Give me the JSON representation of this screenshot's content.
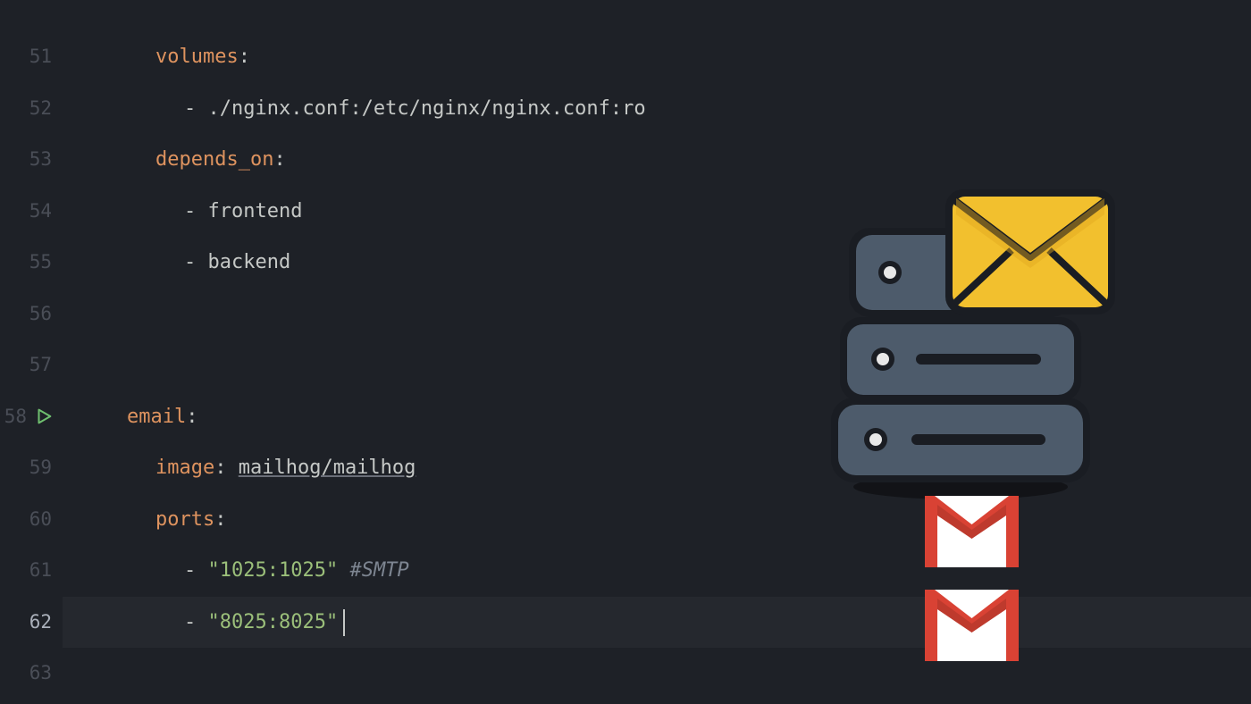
{
  "gutter": {
    "start": 51,
    "active": 62,
    "playAt": 58
  },
  "lines": [
    {
      "num": 51,
      "indent": 2,
      "parts": [
        {
          "t": "key",
          "v": "volumes"
        },
        {
          "t": "colon",
          "v": ":"
        }
      ]
    },
    {
      "num": 52,
      "indent": 3,
      "parts": [
        {
          "t": "dash",
          "v": "- "
        },
        {
          "t": "value",
          "v": "./nginx.conf:/etc/nginx/nginx.conf:ro"
        }
      ]
    },
    {
      "num": 53,
      "indent": 2,
      "parts": [
        {
          "t": "key",
          "v": "depends_on"
        },
        {
          "t": "colon",
          "v": ":"
        }
      ]
    },
    {
      "num": 54,
      "indent": 3,
      "parts": [
        {
          "t": "dash",
          "v": "- "
        },
        {
          "t": "value",
          "v": "frontend"
        }
      ]
    },
    {
      "num": 55,
      "indent": 3,
      "parts": [
        {
          "t": "dash",
          "v": "- "
        },
        {
          "t": "value",
          "v": "backend"
        }
      ]
    },
    {
      "num": 56,
      "indent": 0,
      "parts": []
    },
    {
      "num": 57,
      "indent": 0,
      "parts": []
    },
    {
      "num": 58,
      "indent": 1,
      "parts": [
        {
          "t": "key",
          "v": "email"
        },
        {
          "t": "colon",
          "v": ":"
        }
      ]
    },
    {
      "num": 59,
      "indent": 2,
      "parts": [
        {
          "t": "key",
          "v": "image"
        },
        {
          "t": "colon",
          "v": ": "
        },
        {
          "t": "value-underline",
          "v": "mailhog/mailhog"
        }
      ]
    },
    {
      "num": 60,
      "indent": 2,
      "parts": [
        {
          "t": "key",
          "v": "ports"
        },
        {
          "t": "colon",
          "v": ":"
        }
      ]
    },
    {
      "num": 61,
      "indent": 3,
      "parts": [
        {
          "t": "dash",
          "v": "- "
        },
        {
          "t": "string",
          "v": "\"1025:1025\""
        },
        {
          "t": "value",
          "v": " "
        },
        {
          "t": "comment",
          "v": "#SMTP"
        }
      ]
    },
    {
      "num": 62,
      "indent": 3,
      "highlight": true,
      "cursor": true,
      "parts": [
        {
          "t": "dash",
          "v": "- "
        },
        {
          "t": "string",
          "v": "\"8025:8025\""
        }
      ]
    },
    {
      "num": 63,
      "indent": 0,
      "parts": []
    }
  ],
  "colors": {
    "key": "#de935f",
    "string": "#9bbf7a",
    "comment": "#7d8591",
    "bg": "#1e2127"
  }
}
